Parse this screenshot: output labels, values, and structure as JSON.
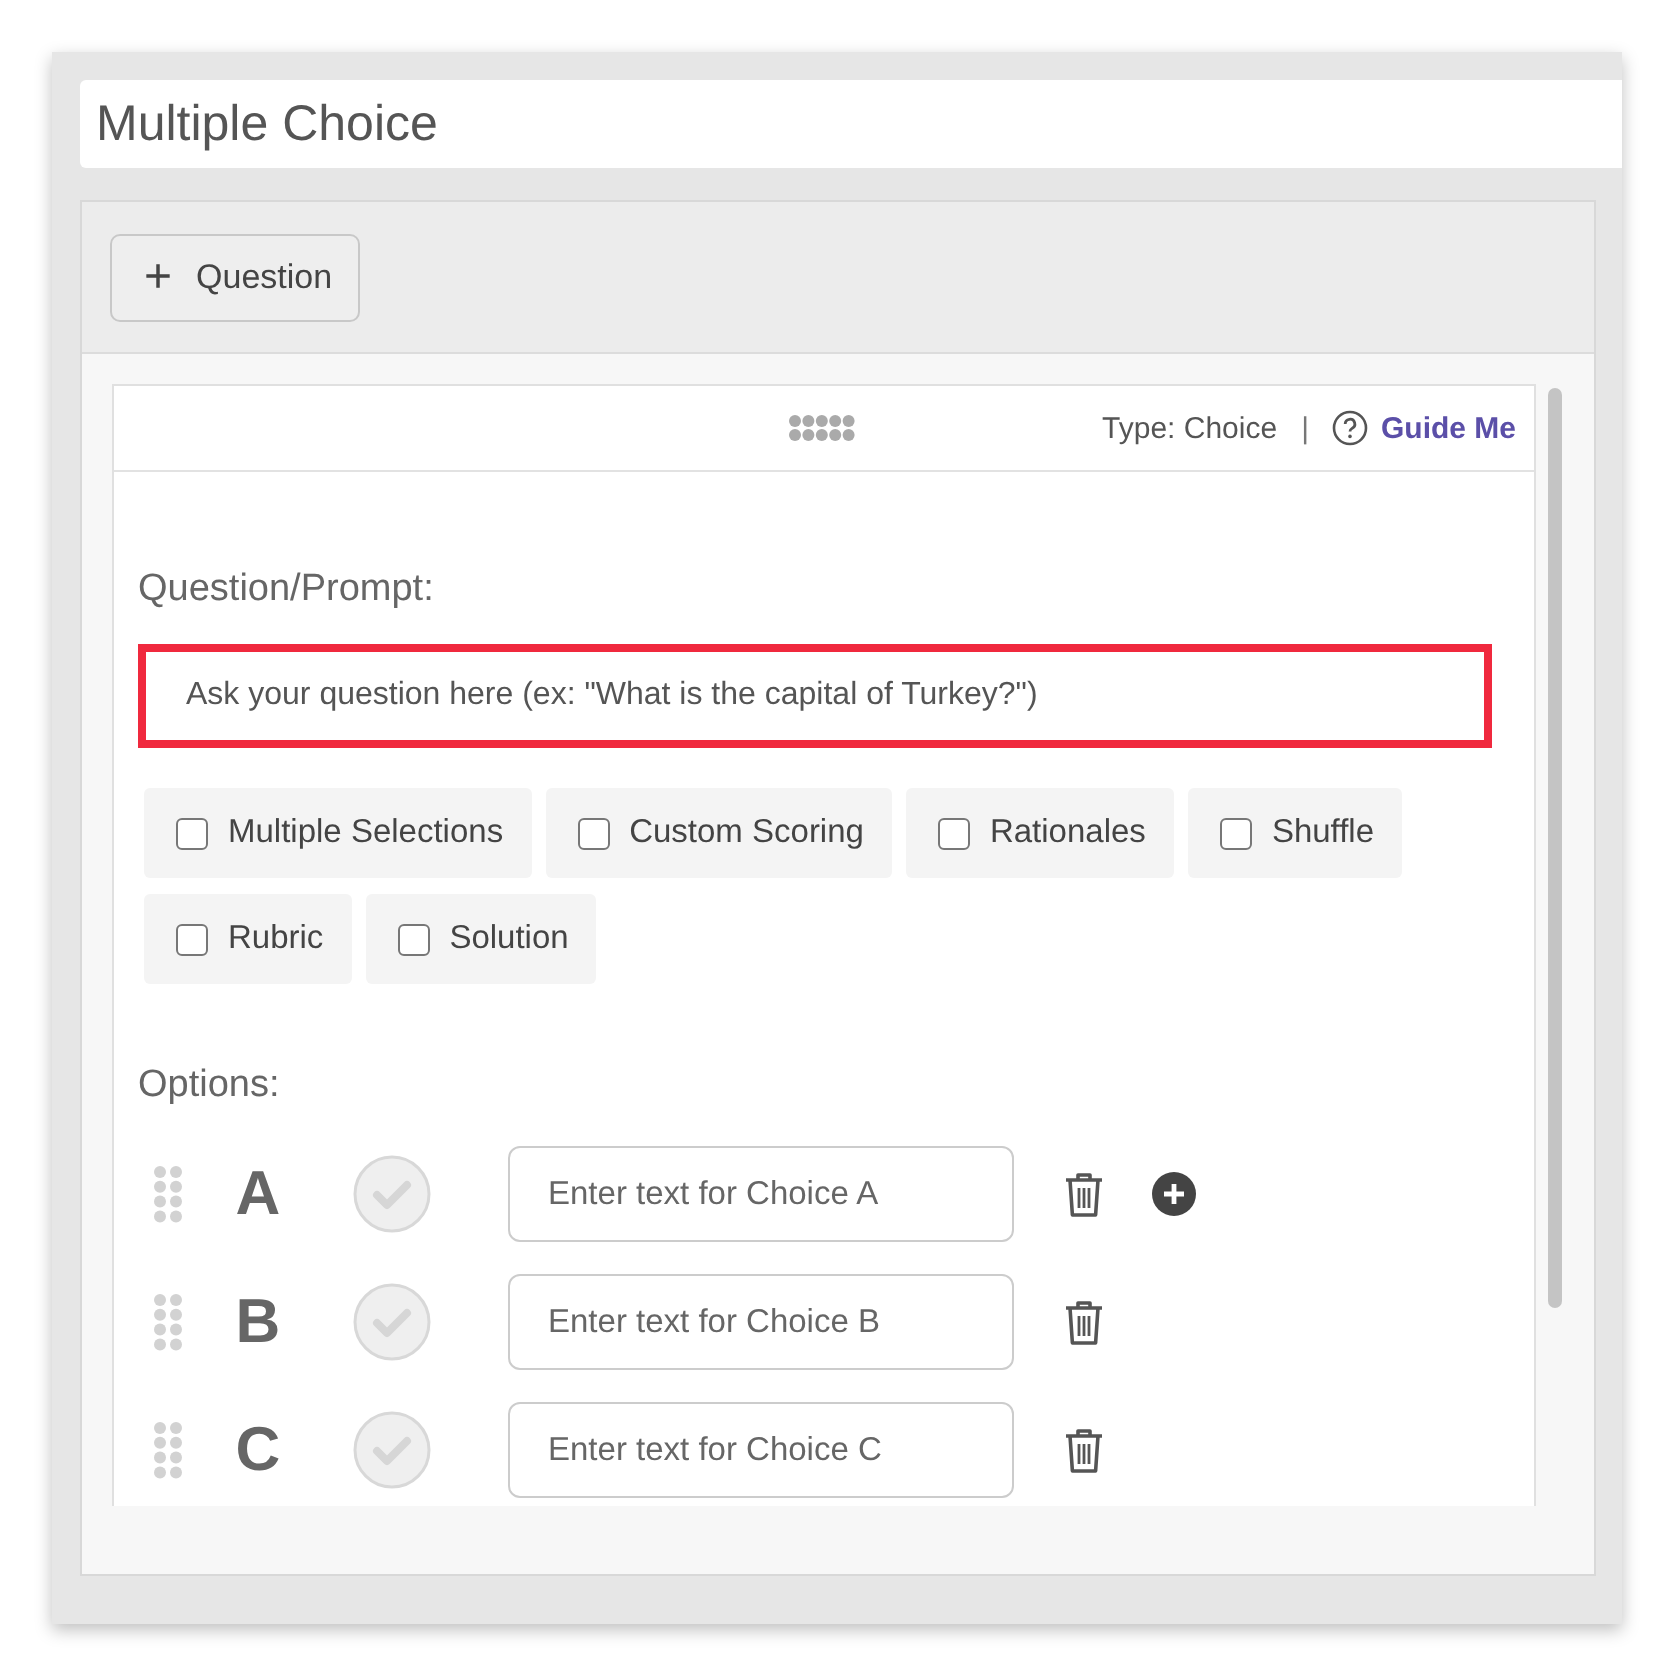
{
  "title_field": {
    "value": "Multiple Choice"
  },
  "add_question_button": {
    "icon": "+",
    "label": "Question"
  },
  "card_header": {
    "type_label": "Type: Choice",
    "separator": "|",
    "guide_link": "Guide Me"
  },
  "prompt": {
    "label": "Question/Prompt:",
    "placeholder": "Ask your question here (ex: \"What is the capital of Turkey?\")",
    "highlighted": true
  },
  "settings": [
    {
      "label": "Multiple Selections",
      "checked": false
    },
    {
      "label": "Custom Scoring",
      "checked": false
    },
    {
      "label": "Rationales",
      "checked": false
    },
    {
      "label": "Shuffle",
      "checked": false
    },
    {
      "label": "Rubric",
      "checked": false
    },
    {
      "label": "Solution",
      "checked": false
    }
  ],
  "options_label": "Options:",
  "options": [
    {
      "letter": "A",
      "correct": false,
      "placeholder": "Enter text for Choice A",
      "add_button": true
    },
    {
      "letter": "B",
      "correct": false,
      "placeholder": "Enter text for Choice B",
      "add_button": false
    },
    {
      "letter": "C",
      "correct": false,
      "placeholder": "Enter text for Choice C",
      "add_button": false
    }
  ]
}
